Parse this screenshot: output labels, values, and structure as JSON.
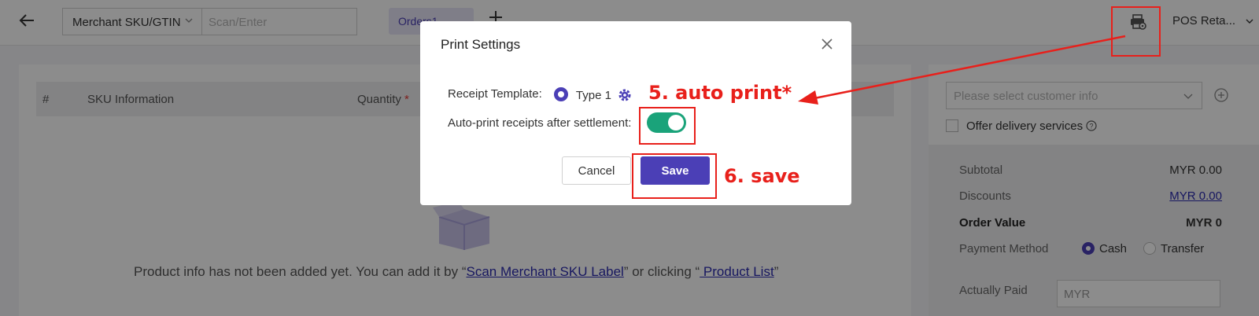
{
  "topbar": {
    "sku_selector": "Merchant SKU/GTIN",
    "scan_placeholder": "Scan/Enter",
    "order_tab": "Orders1",
    "pos_menu": "POS Reta..."
  },
  "table": {
    "headers": [
      "#",
      "SKU Information",
      "Quantity"
    ],
    "required_mark": "*"
  },
  "empty_state": {
    "text_before": "Product info has not been added yet. You can add it by “",
    "link_scan": "Scan Merchant SKU Label",
    "text_middle": "” or clicking “",
    "link_product": " Product List",
    "text_after": "”"
  },
  "right_panel": {
    "customer_placeholder": "Please select customer info",
    "delivery_label": "Offer delivery services",
    "subtotal_label": "Subtotal",
    "subtotal_value": "MYR 0.00",
    "discounts_label": "Discounts",
    "discounts_value": "MYR 0.00",
    "order_value_label": "Order Value",
    "order_value_value": "MYR 0",
    "payment_label": "Payment Method",
    "payment_options": [
      "Cash",
      "Transfer"
    ],
    "payment_selected": "Cash",
    "paid_label": "Actually Paid",
    "paid_placeholder": "MYR"
  },
  "modal": {
    "title": "Print Settings",
    "template_label": "Receipt Template:",
    "template_option": "Type 1",
    "auto_print_label": "Auto-print receipts after settlement:",
    "auto_print_on": true,
    "cancel_label": "Cancel",
    "save_label": "Save"
  },
  "annotations": {
    "step5": "5. auto print*",
    "step6": "6. save",
    "color": "#e8201b"
  },
  "colors": {
    "primary": "#4b3fb6",
    "toggle_on": "#1aa37a",
    "link": "#2b2bb0"
  }
}
